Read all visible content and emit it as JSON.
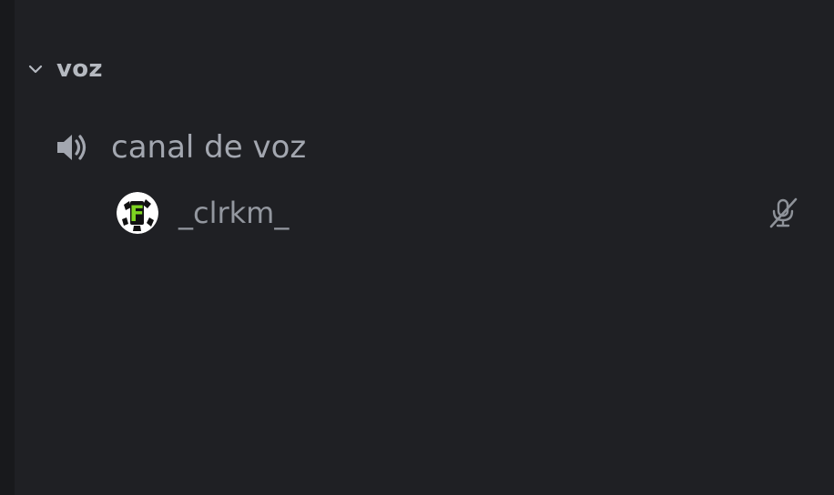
{
  "category": {
    "label": "voz",
    "icon": "chevron-down-icon",
    "expanded": true
  },
  "voice_channel": {
    "name": "canal de voz",
    "icon": "speaker-icon"
  },
  "voice_users": [
    {
      "username": "_clrkm_",
      "avatar_letter": "F",
      "muted": true,
      "status_icon": "mic-muted-icon"
    }
  ],
  "colors": {
    "background": "#1f2024",
    "left_edge": "#18191c",
    "category_text": "#b5b9c0",
    "channel_text": "#a3a7b0",
    "user_text": "#93979f",
    "icon": "#a3a7b0",
    "avatar_green": "#7ed321"
  }
}
